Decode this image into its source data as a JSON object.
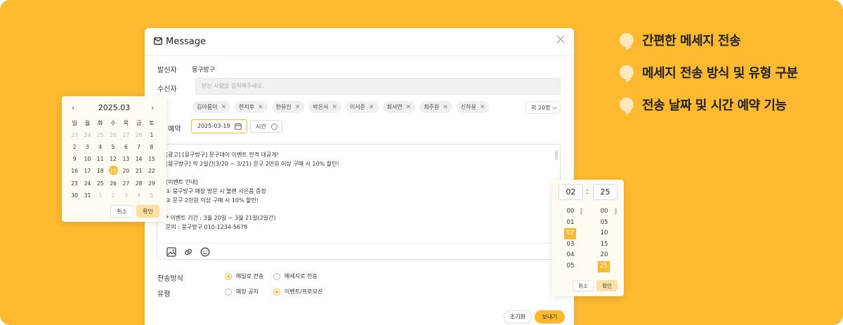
{
  "features": [
    "간편한 메세지 전송",
    "메세지 전송 방식 및 유형 구분",
    "전송 날짜 및 시간 예약 기능"
  ],
  "message": {
    "title": "Message",
    "sender_label": "발신자",
    "sender_value": "뭉구방구",
    "recipient_label": "수신자",
    "recipient_placeholder": "받는 사람을 입력해주세요.",
    "recipients": [
      "김아름이",
      "한지후",
      "한유진",
      "박은서",
      "이서준",
      "최서연",
      "최주원",
      "신하윤"
    ],
    "more_label": "외 20명",
    "schedule_label": "예약",
    "schedule_date": "2025-03-19",
    "time_button": "시간",
    "body": "[광고] [뭉구방구] 문구데이 이벤트 전격 대공개!\n[뭉구방구] 딱 2일간(3/20 ~ 3/21) 문구 2만원 이상 구매 시 10% 할인!\n\n[이벤트 안내]\n① 뭉구방구 매장 방문 시 볼펜 사은품 증정\n② 문구 2만원 이상 구매 시 10% 할인!\n\n* 이벤트 기간 : 3월 20일 ~ 3월 21일(2일간)\n문의 : 뭉구방구 010-1234-5678",
    "method_label": "전송방식",
    "method_options": [
      "메일로 전송",
      "메세지로 전송"
    ],
    "type_label": "유형",
    "type_options": [
      "매장 공지",
      "이벤트/프로모션"
    ],
    "reset_button": "초기화",
    "send_button": "보내기"
  },
  "calendar": {
    "month": "2025.03",
    "weekdays": [
      "일",
      "월",
      "화",
      "수",
      "목",
      "금",
      "토"
    ],
    "days": [
      23,
      24,
      25,
      26,
      27,
      28,
      1,
      2,
      3,
      4,
      5,
      6,
      7,
      8,
      9,
      10,
      11,
      12,
      13,
      14,
      15,
      16,
      17,
      18,
      19,
      20,
      21,
      22,
      23,
      24,
      25,
      26,
      27,
      28,
      29,
      30,
      31,
      1,
      2,
      3,
      4,
      5
    ],
    "leading_dim": 6,
    "trailing_dim": 5,
    "selected": 19,
    "cancel": "취소",
    "confirm": "확인"
  },
  "timepicker": {
    "hour": "02",
    "minute": "25",
    "hours": [
      "00",
      "01",
      "02",
      "03",
      "04",
      "05"
    ],
    "minutes": [
      "00",
      "05",
      "10",
      "15",
      "20",
      "25"
    ],
    "selected_hour": "02",
    "selected_minute": "25",
    "cancel": "취소",
    "confirm": "확인"
  }
}
